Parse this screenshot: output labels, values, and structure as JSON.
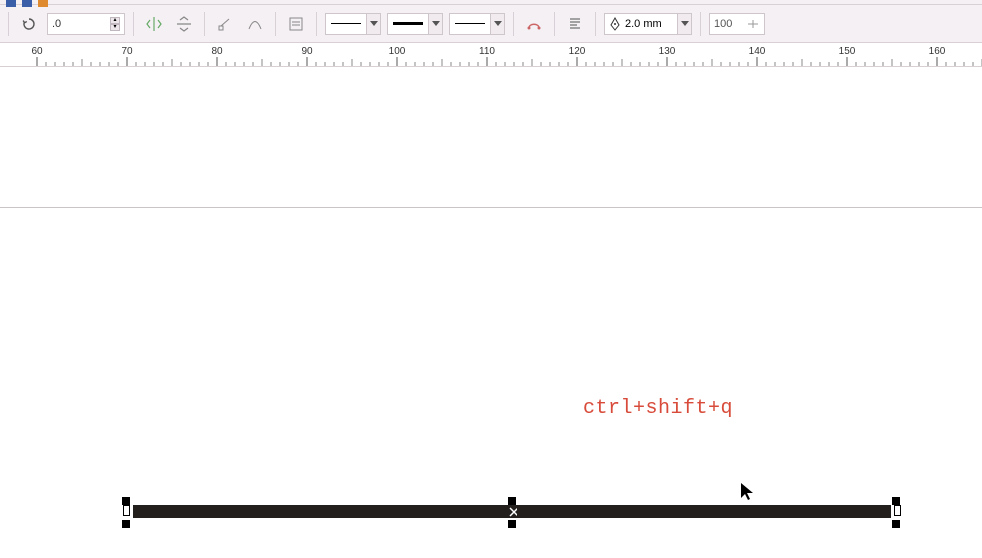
{
  "topbar": {},
  "propbar": {
    "rotation": ".0",
    "outline_width": "2.0 mm",
    "opacity": "100"
  },
  "ruler": {
    "start": 60,
    "end": 160,
    "step": 10
  },
  "canvas": {
    "shortcut_label": "ctrl+shift+q"
  }
}
